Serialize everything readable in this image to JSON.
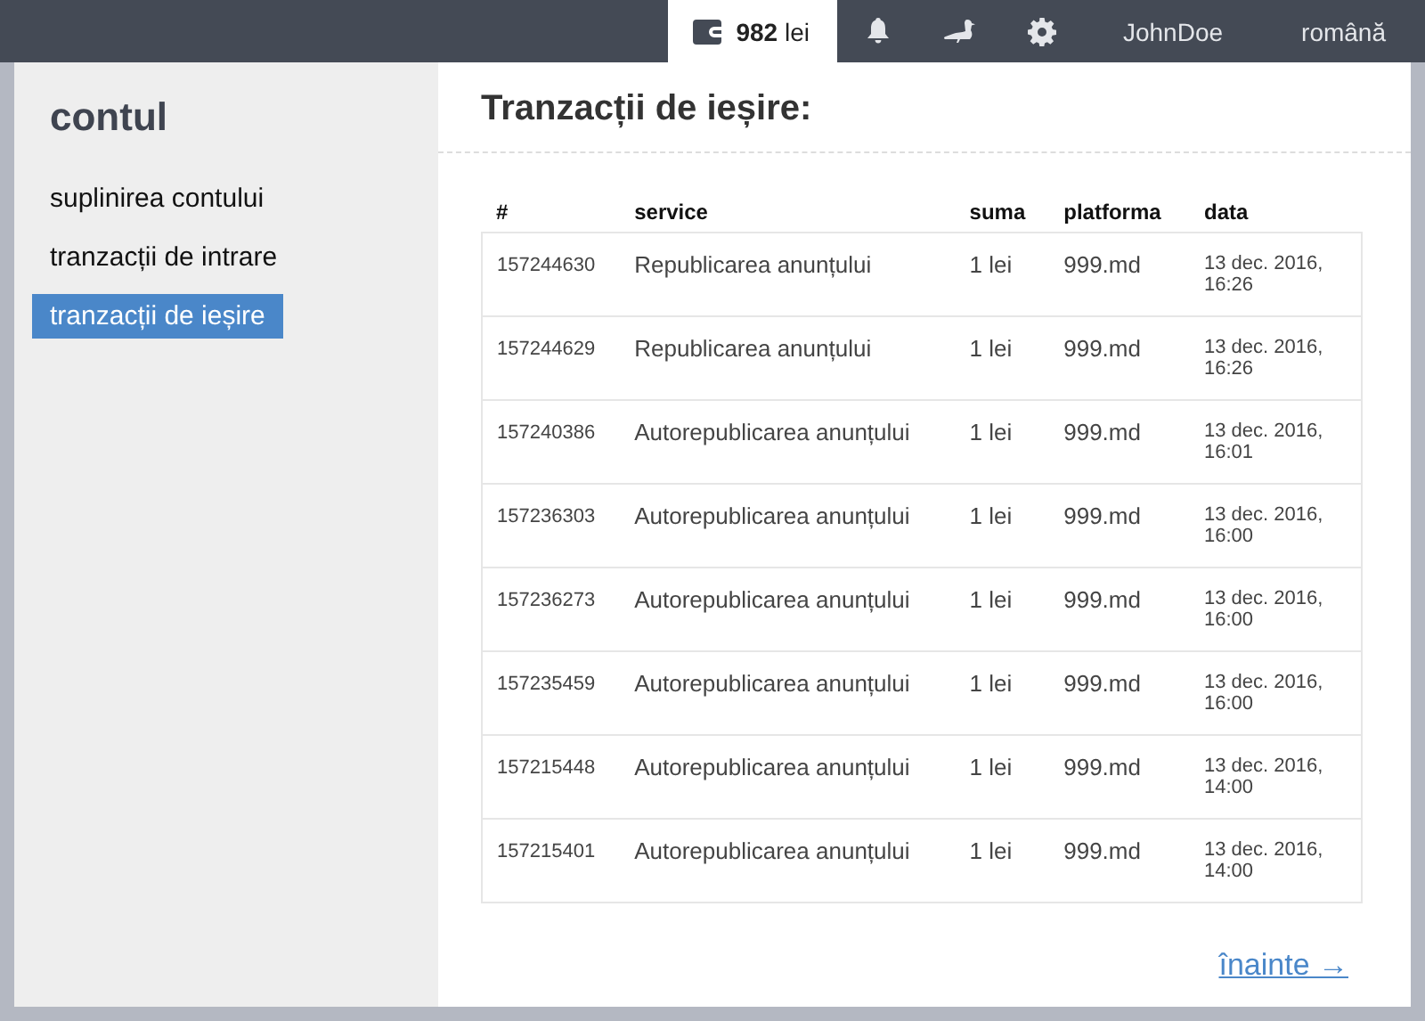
{
  "topbar": {
    "items": [
      {
        "kind": "balance",
        "label": "**982** lei",
        "selected": true
      },
      {
        "kind": "bell",
        "selected": false
      },
      {
        "kind": "duck",
        "selected": false
      },
      {
        "kind": "gear",
        "selected": false
      },
      {
        "kind": "text",
        "label": "JohnDoe",
        "selected": false
      },
      {
        "kind": "text",
        "label": "română",
        "selected": false
      }
    ]
  },
  "sidebar": {
    "title": "contul",
    "items": [
      {
        "label": "suplinirea contului",
        "selected": false
      },
      {
        "label": "tranzacții de intrare",
        "selected": false
      },
      {
        "label": "tranzacții de ieșire",
        "selected": true
      }
    ]
  },
  "main": {
    "title": "Tranzacții de ieșire:",
    "table": {
      "columns": [
        "#",
        "service",
        "suma",
        "platforma",
        "data"
      ],
      "rows": [
        [
          "157244630",
          "Republicarea anunțului",
          "1 lei",
          "999.md",
          "13 dec. 2016, 16:26"
        ],
        [
          "157244629",
          "Republicarea anunțului",
          "1 lei",
          "999.md",
          "13 dec. 2016, 16:26"
        ],
        [
          "157240386",
          "Autorepublicarea anunțului",
          "1 lei",
          "999.md",
          "13 dec. 2016, 16:01"
        ],
        [
          "157236303",
          "Autorepublicarea anunțului",
          "1 lei",
          "999.md",
          "13 dec. 2016, 16:00"
        ],
        [
          "157236273",
          "Autorepublicarea anunțului",
          "1 lei",
          "999.md",
          "13 dec. 2016, 16:00"
        ],
        [
          "157235459",
          "Autorepublicarea anunțului",
          "1 lei",
          "999.md",
          "13 dec. 2016, 16:00"
        ],
        [
          "157215448",
          "Autorepublicarea anunțului",
          "1 lei",
          "999.md",
          "13 dec. 2016, 14:00"
        ],
        [
          "157215401",
          "Autorepublicarea anunțului",
          "1 lei",
          "999.md",
          "13 dec. 2016, 14:00"
        ]
      ]
    },
    "next_link": "înainte →"
  }
}
